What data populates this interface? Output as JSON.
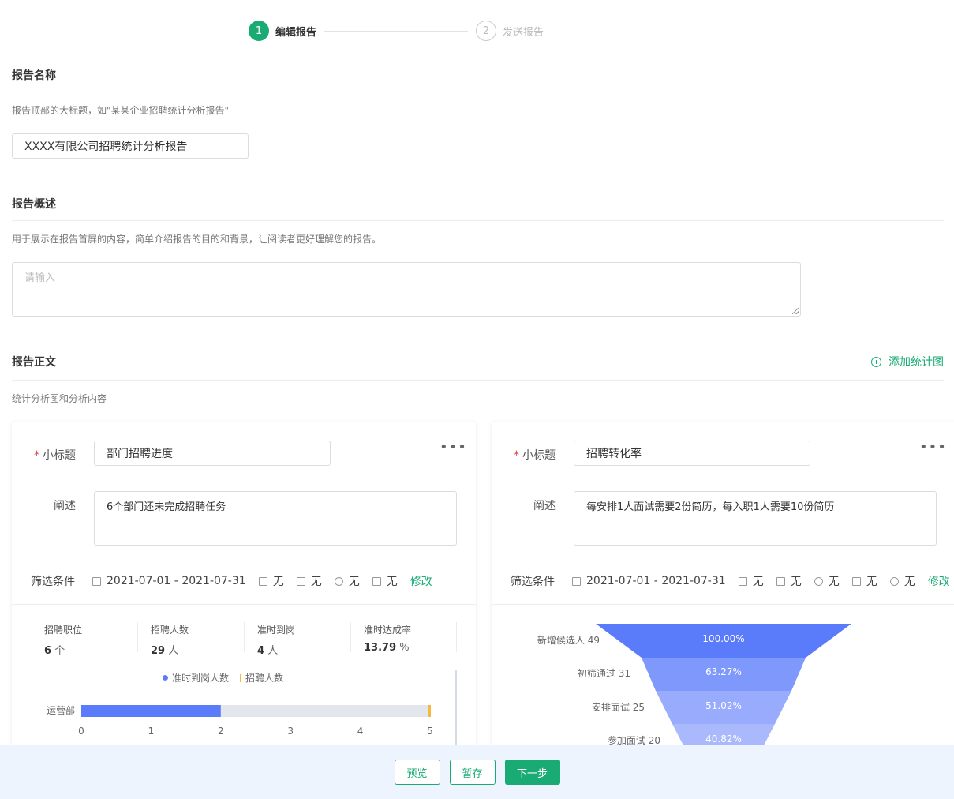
{
  "steps": [
    {
      "num": "1",
      "label": "编辑报告"
    },
    {
      "num": "2",
      "label": "发送报告"
    }
  ],
  "report_name": {
    "title": "报告名称",
    "hint": "报告顶部的大标题，如\"某某企业招聘统计分析报告\"",
    "value": "XXXX有限公司招聘统计分析报告"
  },
  "overview": {
    "title": "报告概述",
    "hint": "用于展示在报告首屏的内容，简单介绍报告的目的和背景，让阅读者更好理解您的报告。",
    "placeholder": "请输入"
  },
  "body": {
    "title": "报告正文",
    "hint": "统计分析图和分析内容",
    "add_chart": "添加统计图"
  },
  "cards": [
    {
      "subtitle_label": "小标题",
      "subtitle_value": "部门招聘进度",
      "desc_label": "阐述",
      "desc_value": "6个部门还未完成招聘任务",
      "filter_label": "筛选条件",
      "date_range": "2021-07-01 - 2021-07-31",
      "filters": [
        "无",
        "无",
        "无",
        "无"
      ],
      "modify": "修改",
      "more": "•••",
      "stats": [
        {
          "label": "招聘职位",
          "value": "6",
          "unit": "个"
        },
        {
          "label": "招聘人数",
          "value": "29",
          "unit": "人"
        },
        {
          "label": "准时到岗",
          "value": "4",
          "unit": "人"
        },
        {
          "label": "准时达成率",
          "value": "13.79",
          "unit": "%"
        }
      ],
      "legend": [
        "准时到岗人数",
        "招聘人数"
      ],
      "bar_chart": {
        "category": "运营部",
        "on_time": 2,
        "hired": 5,
        "ticks": [
          "0",
          "1",
          "2",
          "3",
          "4",
          "5"
        ]
      }
    },
    {
      "subtitle_label": "小标题",
      "subtitle_value": "招聘转化率",
      "desc_label": "阐述",
      "desc_value": "每安排1人面试需要2份简历，每入职1人需要10份简历",
      "filter_label": "筛选条件",
      "date_range": "2021-07-01 - 2021-07-31",
      "filters": [
        "无",
        "无",
        "无",
        "无",
        "无"
      ],
      "modify": "修改",
      "more": "•••",
      "funnel": [
        {
          "label": "新增候选人 49",
          "pct": "100.00%"
        },
        {
          "label": "初筛通过 31",
          "pct": "63.27%"
        },
        {
          "label": "安排面试 25",
          "pct": "51.02%"
        },
        {
          "label": "参加面试 20",
          "pct": "40.82%"
        }
      ]
    }
  ],
  "footer": {
    "preview": "预览",
    "save": "暂存",
    "next": "下一步"
  },
  "colors": {
    "accent": "#1aab74",
    "bar": "#5b7cfa",
    "bar_bg": "#e3e7ed",
    "hired_marker": "#f5b940"
  }
}
